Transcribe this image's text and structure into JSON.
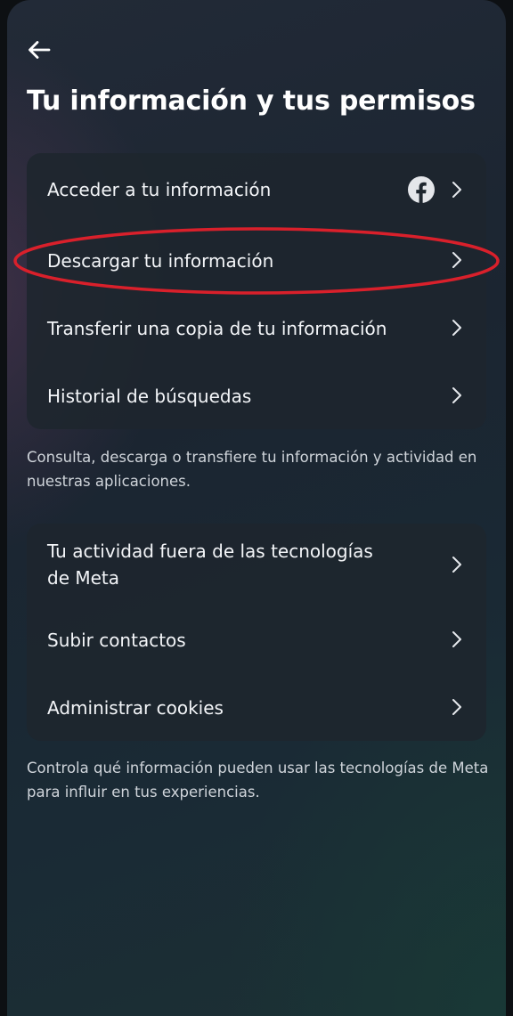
{
  "page_title": "Tu información y tus permisos",
  "colors": {
    "annotation": "#d9202b",
    "card_bg": "#1e262e",
    "text": "#f3f5f8"
  },
  "section_1": {
    "items": [
      {
        "label": "Acceder a tu información",
        "icon": "facebook-icon"
      },
      {
        "label": "Descargar tu información"
      },
      {
        "label": "Transferir una copia de tu información"
      },
      {
        "label": "Historial de búsquedas"
      }
    ],
    "description": "Consulta, descarga o transfiere tu información y actividad en nuestras aplicaciones."
  },
  "section_2": {
    "items": [
      {
        "label_line1": "Tu actividad fuera de las tecnologías",
        "label_line2": "de Meta"
      },
      {
        "label": "Subir contactos"
      },
      {
        "label": "Administrar cookies"
      }
    ],
    "description": "Controla qué información pueden usar las tecnologías de Meta para influir en tus experiencias."
  }
}
